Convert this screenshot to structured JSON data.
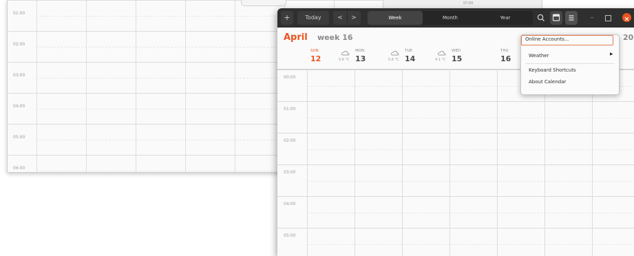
{
  "background_window": {
    "time_labels": [
      "01:00",
      "02:00",
      "03:00",
      "04:00",
      "05:00",
      "06:00"
    ]
  },
  "peek_window": {
    "text": "07:00"
  },
  "front_window": {
    "headerbar": {
      "new_event": "+",
      "today": "Today",
      "prev": "<",
      "next": ">",
      "views": [
        "Week",
        "Month",
        "Year"
      ],
      "active_view": "Week",
      "minimize": "–"
    },
    "month": "April",
    "week": "week 16",
    "year_peek": "20",
    "days": [
      {
        "abbr": "SUN",
        "num": "12",
        "today": true,
        "temp": ""
      },
      {
        "abbr": "MON",
        "num": "13",
        "today": false,
        "temp": "5.6 °C"
      },
      {
        "abbr": "TUE",
        "num": "14",
        "today": false,
        "temp": "5.6 °C"
      },
      {
        "abbr": "WED",
        "num": "15",
        "today": false,
        "temp": "4.1 °C"
      },
      {
        "abbr": "THU",
        "num": "16",
        "today": false,
        "temp": ""
      }
    ],
    "time_labels": [
      "00:00",
      "01:00",
      "02:00",
      "03:00",
      "04:00",
      "05:00"
    ]
  },
  "menu": {
    "items": [
      "Online Accounts...",
      "Weather",
      "Keyboard Shortcuts",
      "About Calendar"
    ]
  },
  "colors": {
    "accent": "#e95420",
    "headerbar": "#2f2f2f"
  }
}
